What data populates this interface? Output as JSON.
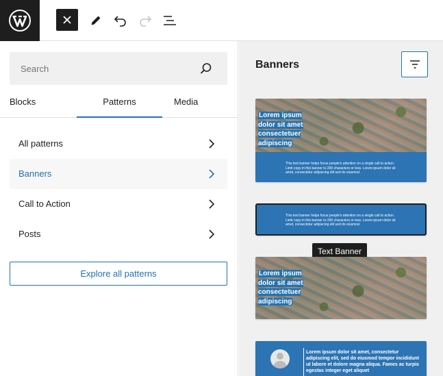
{
  "topbar": {
    "logo": "wordpress-logo",
    "close_icon": "close-icon",
    "edit_icon": "pencil-icon",
    "undo_icon": "undo-icon",
    "redo_icon": "redo-icon",
    "list_view_icon": "list-view-icon"
  },
  "sidebar": {
    "search": {
      "placeholder": "Search",
      "value": ""
    },
    "tabs": [
      {
        "label": "Blocks",
        "active": false
      },
      {
        "label": "Patterns",
        "active": true
      },
      {
        "label": "Media",
        "active": false
      }
    ],
    "categories": [
      {
        "label": "All patterns",
        "active": false
      },
      {
        "label": "Banners",
        "active": true
      },
      {
        "label": "Call to Action",
        "active": false
      },
      {
        "label": "Posts",
        "active": false
      }
    ],
    "explore_label": "Explore all patterns"
  },
  "panel": {
    "title": "Banners",
    "filter_icon": "filter-icon",
    "hero_text": "Lorem ipsum dolor sit amet consectetuer adipiscing",
    "banner_small_text": "This text banner helps focus people's attention on a single call to action. Limit copy in this banner to 200 characters or less. Lorem ipsum dolor sit amet, consectetur adipiscing elit sed do eiusmod.",
    "tooltip": "Text Banner",
    "quote_text": "Lorem ipsum dolor sit amet, consectetur adipiscing elit, sed do eiusmod tempor incididunt ut labore et dolore magna aliqua. Fames ac turpis egestas integer eget aliquet"
  },
  "colors": {
    "accent": "#2271b1",
    "banner_blue": "#2c74b3",
    "dark": "#1e1e1e",
    "panel_bg": "#f0f0f0"
  }
}
